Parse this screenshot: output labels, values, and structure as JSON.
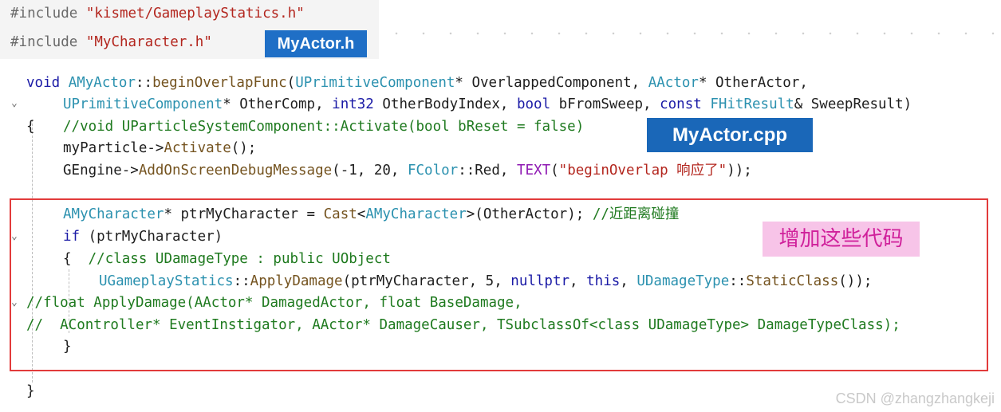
{
  "header_snippet": {
    "line1": {
      "kw": "#include",
      "str": "\"kismet/GameplayStatics.h\""
    },
    "line2": {
      "kw": "#include",
      "str": "\"MyCharacter.h\""
    },
    "badge": "MyActor.h"
  },
  "code": {
    "l1": [
      "void",
      "AMyActor",
      "::",
      "beginOverlapFunc",
      "(",
      "UPrimitiveComponent",
      "* OverlappedComponent, ",
      "AActor",
      "* OtherActor,"
    ],
    "l2": [
      "UPrimitiveComponent",
      "* OtherComp, ",
      "int32",
      " OtherBodyIndex, ",
      "bool",
      " bFromSweep, ",
      "const",
      " ",
      "FHitResult",
      "& SweepResult)"
    ],
    "l3": [
      "{",
      "//void UParticleSystemComponent::Activate(bool bReset = false)"
    ],
    "l4": [
      "myParticle->",
      "Activate",
      "();"
    ],
    "l5": [
      "GEngine->",
      "AddOnScreenDebugMessage",
      "(-1, 20, ",
      "FColor",
      "::Red, ",
      "TEXT",
      "(",
      "\"beginOverlap 响应了\"",
      "));"
    ],
    "l6": [
      "AMyCharacter",
      "* ptrMyCharacter = ",
      "Cast",
      "<",
      "AMyCharacter",
      ">(OtherActor); ",
      "//近距离碰撞"
    ],
    "l7": [
      "if",
      " (ptrMyCharacter)"
    ],
    "l8": [
      "{",
      "//class UDamageType : public UObject"
    ],
    "l9": [
      "UGameplayStatics",
      "::",
      "ApplyDamage",
      "(ptrMyCharacter, 5, ",
      "nullptr",
      ", ",
      "this",
      ", ",
      "UDamageType",
      "::",
      "StaticClass",
      "());"
    ],
    "l10": [
      "//float ApplyDamage(AActor* DamagedActor, float BaseDamage,"
    ],
    "l11": [
      "//  AController* EventInstigator, AActor* DamageCauser, TSubclassOf<class UDamageType> DamageTypeClass);"
    ],
    "l12": [
      "}"
    ],
    "l13": [
      "}"
    ]
  },
  "labels": {
    "cpp_badge": "MyActor.cpp",
    "add_code_note": "增加这些代码"
  },
  "watermark": "CSDN @zhangzhangkeji",
  "colors": {
    "highlight_border": "#e23b3b",
    "badge_blue": "#1f6fc6",
    "note_pink": "#f7c4e8"
  }
}
